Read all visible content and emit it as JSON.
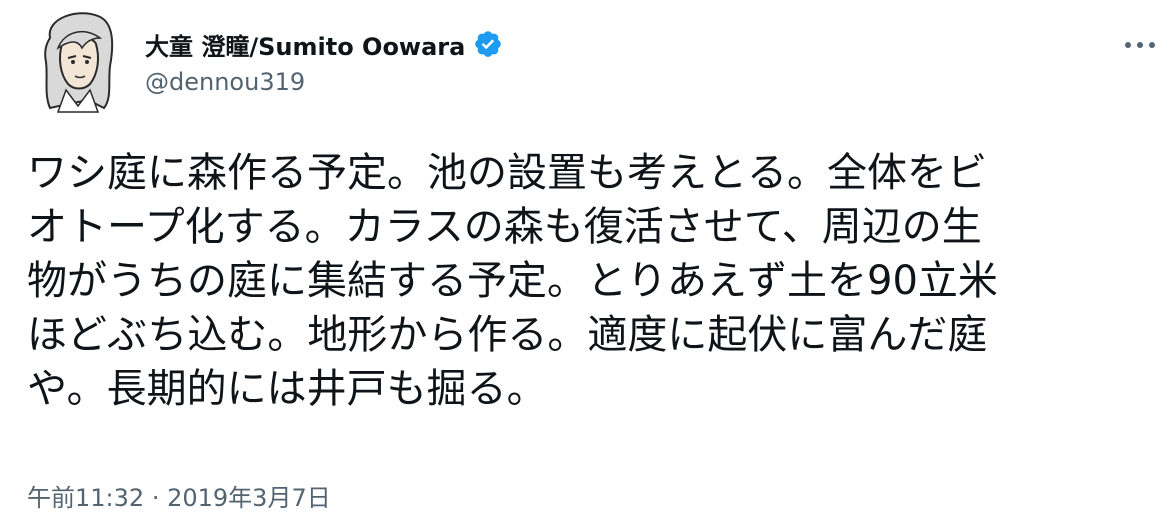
{
  "author": {
    "display_name": "大童 澄瞳/Sumito Oowara",
    "handle": "@dennou319",
    "verified": true,
    "avatar_icon": "avatar-illustration-icon"
  },
  "tweet": {
    "lines": [
      "ワシ庭に森作る予定。池の設置も考えとる。全体をビ",
      "オトープ化する。カラスの森も復活させて、周辺の生",
      "物がうちの庭に集結する予定。とりあえず土を90立米",
      "ほどぶち込む。地形から作る。適度に起伏に富んだ庭",
      "や。長期的には井戸も掘る。"
    ],
    "time": "午前11:32",
    "separator": "·",
    "date": "2019年3月7日"
  },
  "icons": {
    "verified": "verified-badge-icon",
    "more": "more-options-icon"
  },
  "colors": {
    "text": "#0f1419",
    "secondary": "#536471",
    "verified": "#1d9bf0"
  }
}
